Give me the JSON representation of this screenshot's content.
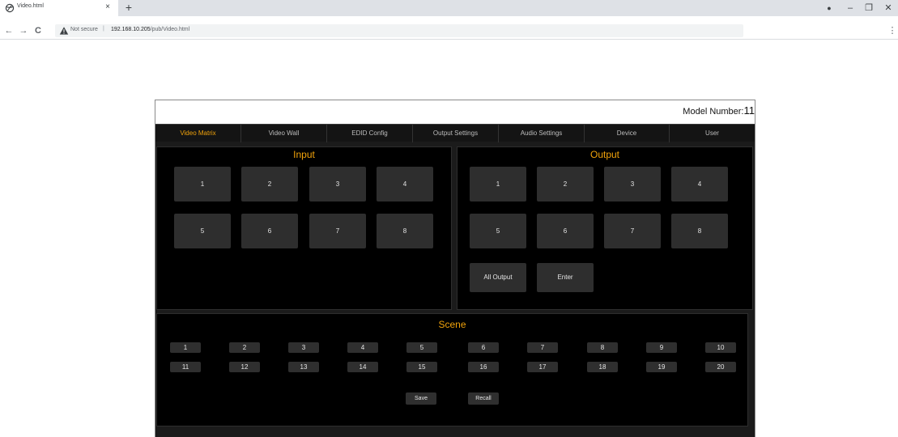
{
  "browser": {
    "tab_title": "Video.html",
    "tab_close": "×",
    "new_tab": "+",
    "not_secure": "Not secure",
    "url_host": "192.168.10.205",
    "url_path": "/pub/Video.html",
    "window_controls": {
      "account": "●",
      "minimize": "–",
      "restore": "❐",
      "close": "✕"
    },
    "nav": {
      "back": "←",
      "forward": "→",
      "reload": "C",
      "menu": "⋮"
    }
  },
  "header": {
    "model_label": "Model Number:",
    "model_value": "11"
  },
  "nav_tabs": [
    {
      "label": "Video Matrix",
      "active": true
    },
    {
      "label": "Video Wall",
      "active": false
    },
    {
      "label": "EDID Config",
      "active": false
    },
    {
      "label": "Output Settings",
      "active": false
    },
    {
      "label": "Audio Settings",
      "active": false
    },
    {
      "label": "Device",
      "active": false
    },
    {
      "label": "User",
      "active": false
    }
  ],
  "input": {
    "title": "Input",
    "buttons": [
      "1",
      "2",
      "3",
      "4",
      "5",
      "6",
      "7",
      "8"
    ]
  },
  "output": {
    "title": "Output",
    "buttons": [
      "1",
      "2",
      "3",
      "4",
      "5",
      "6",
      "7",
      "8"
    ],
    "all_output_label": "All Output",
    "enter_label": "Enter"
  },
  "scene": {
    "title": "Scene",
    "buttons": [
      "1",
      "2",
      "3",
      "4",
      "5",
      "6",
      "7",
      "8",
      "9",
      "10",
      "11",
      "12",
      "13",
      "14",
      "15",
      "16",
      "17",
      "18",
      "19",
      "20"
    ],
    "save_label": "Save",
    "recall_label": "Recall"
  },
  "colors": {
    "accent": "#f0a20b",
    "panel_bg": "#000000",
    "tile_bg": "#2e2e2e",
    "frame_bg": "#1b1b1b"
  }
}
